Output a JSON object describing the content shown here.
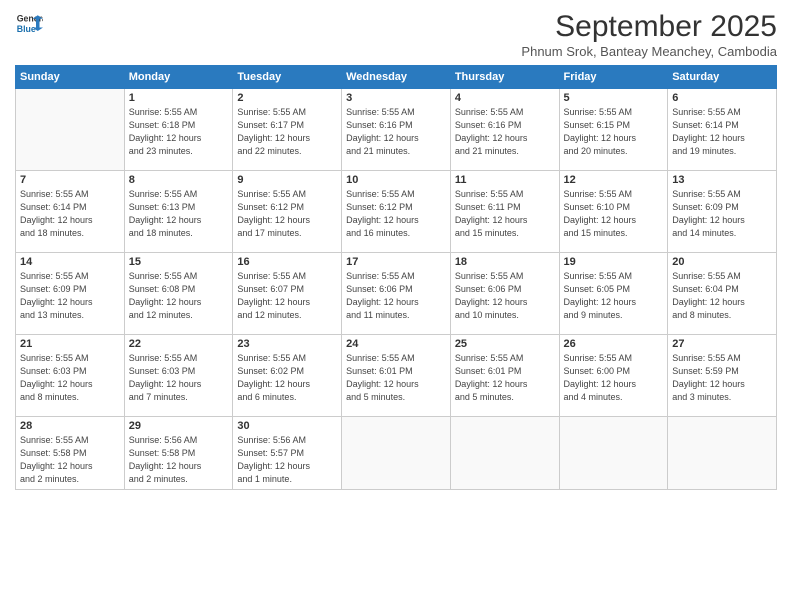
{
  "logo": {
    "line1": "General",
    "line2": "Blue"
  },
  "title": "September 2025",
  "subtitle": "Phnum Srok, Banteay Meanchey, Cambodia",
  "days_of_week": [
    "Sunday",
    "Monday",
    "Tuesday",
    "Wednesday",
    "Thursday",
    "Friday",
    "Saturday"
  ],
  "weeks": [
    [
      {
        "day": "",
        "info": ""
      },
      {
        "day": "1",
        "info": "Sunrise: 5:55 AM\nSunset: 6:18 PM\nDaylight: 12 hours\nand 23 minutes."
      },
      {
        "day": "2",
        "info": "Sunrise: 5:55 AM\nSunset: 6:17 PM\nDaylight: 12 hours\nand 22 minutes."
      },
      {
        "day": "3",
        "info": "Sunrise: 5:55 AM\nSunset: 6:16 PM\nDaylight: 12 hours\nand 21 minutes."
      },
      {
        "day": "4",
        "info": "Sunrise: 5:55 AM\nSunset: 6:16 PM\nDaylight: 12 hours\nand 21 minutes."
      },
      {
        "day": "5",
        "info": "Sunrise: 5:55 AM\nSunset: 6:15 PM\nDaylight: 12 hours\nand 20 minutes."
      },
      {
        "day": "6",
        "info": "Sunrise: 5:55 AM\nSunset: 6:14 PM\nDaylight: 12 hours\nand 19 minutes."
      }
    ],
    [
      {
        "day": "7",
        "info": "Sunrise: 5:55 AM\nSunset: 6:14 PM\nDaylight: 12 hours\nand 18 minutes."
      },
      {
        "day": "8",
        "info": "Sunrise: 5:55 AM\nSunset: 6:13 PM\nDaylight: 12 hours\nand 18 minutes."
      },
      {
        "day": "9",
        "info": "Sunrise: 5:55 AM\nSunset: 6:12 PM\nDaylight: 12 hours\nand 17 minutes."
      },
      {
        "day": "10",
        "info": "Sunrise: 5:55 AM\nSunset: 6:12 PM\nDaylight: 12 hours\nand 16 minutes."
      },
      {
        "day": "11",
        "info": "Sunrise: 5:55 AM\nSunset: 6:11 PM\nDaylight: 12 hours\nand 15 minutes."
      },
      {
        "day": "12",
        "info": "Sunrise: 5:55 AM\nSunset: 6:10 PM\nDaylight: 12 hours\nand 15 minutes."
      },
      {
        "day": "13",
        "info": "Sunrise: 5:55 AM\nSunset: 6:09 PM\nDaylight: 12 hours\nand 14 minutes."
      }
    ],
    [
      {
        "day": "14",
        "info": "Sunrise: 5:55 AM\nSunset: 6:09 PM\nDaylight: 12 hours\nand 13 minutes."
      },
      {
        "day": "15",
        "info": "Sunrise: 5:55 AM\nSunset: 6:08 PM\nDaylight: 12 hours\nand 12 minutes."
      },
      {
        "day": "16",
        "info": "Sunrise: 5:55 AM\nSunset: 6:07 PM\nDaylight: 12 hours\nand 12 minutes."
      },
      {
        "day": "17",
        "info": "Sunrise: 5:55 AM\nSunset: 6:06 PM\nDaylight: 12 hours\nand 11 minutes."
      },
      {
        "day": "18",
        "info": "Sunrise: 5:55 AM\nSunset: 6:06 PM\nDaylight: 12 hours\nand 10 minutes."
      },
      {
        "day": "19",
        "info": "Sunrise: 5:55 AM\nSunset: 6:05 PM\nDaylight: 12 hours\nand 9 minutes."
      },
      {
        "day": "20",
        "info": "Sunrise: 5:55 AM\nSunset: 6:04 PM\nDaylight: 12 hours\nand 8 minutes."
      }
    ],
    [
      {
        "day": "21",
        "info": "Sunrise: 5:55 AM\nSunset: 6:03 PM\nDaylight: 12 hours\nand 8 minutes."
      },
      {
        "day": "22",
        "info": "Sunrise: 5:55 AM\nSunset: 6:03 PM\nDaylight: 12 hours\nand 7 minutes."
      },
      {
        "day": "23",
        "info": "Sunrise: 5:55 AM\nSunset: 6:02 PM\nDaylight: 12 hours\nand 6 minutes."
      },
      {
        "day": "24",
        "info": "Sunrise: 5:55 AM\nSunset: 6:01 PM\nDaylight: 12 hours\nand 5 minutes."
      },
      {
        "day": "25",
        "info": "Sunrise: 5:55 AM\nSunset: 6:01 PM\nDaylight: 12 hours\nand 5 minutes."
      },
      {
        "day": "26",
        "info": "Sunrise: 5:55 AM\nSunset: 6:00 PM\nDaylight: 12 hours\nand 4 minutes."
      },
      {
        "day": "27",
        "info": "Sunrise: 5:55 AM\nSunset: 5:59 PM\nDaylight: 12 hours\nand 3 minutes."
      }
    ],
    [
      {
        "day": "28",
        "info": "Sunrise: 5:55 AM\nSunset: 5:58 PM\nDaylight: 12 hours\nand 2 minutes."
      },
      {
        "day": "29",
        "info": "Sunrise: 5:56 AM\nSunset: 5:58 PM\nDaylight: 12 hours\nand 2 minutes."
      },
      {
        "day": "30",
        "info": "Sunrise: 5:56 AM\nSunset: 5:57 PM\nDaylight: 12 hours\nand 1 minute."
      },
      {
        "day": "",
        "info": ""
      },
      {
        "day": "",
        "info": ""
      },
      {
        "day": "",
        "info": ""
      },
      {
        "day": "",
        "info": ""
      }
    ]
  ]
}
